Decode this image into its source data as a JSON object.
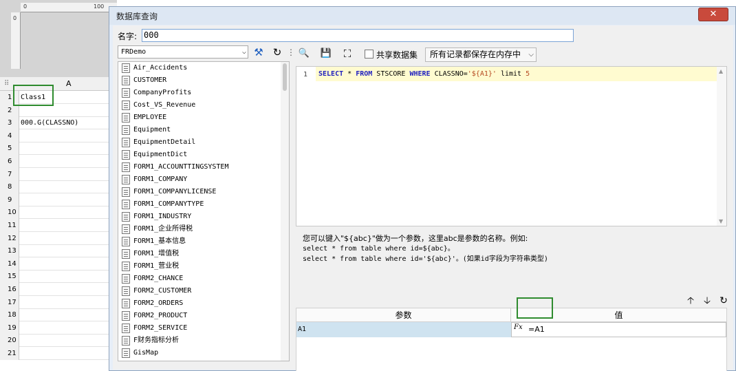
{
  "sheet": {
    "ruler_marks": [
      "0",
      "100"
    ],
    "ruler_left_mark": "0",
    "column_a": "A",
    "rows": [
      {
        "num": "1",
        "value": "Class1"
      },
      {
        "num": "2",
        "value": ""
      },
      {
        "num": "3",
        "value": "000.G(CLASSNO)"
      },
      {
        "num": "4",
        "value": ""
      },
      {
        "num": "5",
        "value": ""
      },
      {
        "num": "6",
        "value": ""
      },
      {
        "num": "7",
        "value": ""
      },
      {
        "num": "8",
        "value": ""
      },
      {
        "num": "9",
        "value": ""
      },
      {
        "num": "10",
        "value": ""
      },
      {
        "num": "11",
        "value": ""
      },
      {
        "num": "12",
        "value": ""
      },
      {
        "num": "13",
        "value": ""
      },
      {
        "num": "14",
        "value": ""
      },
      {
        "num": "15",
        "value": ""
      },
      {
        "num": "16",
        "value": ""
      },
      {
        "num": "17",
        "value": ""
      },
      {
        "num": "18",
        "value": ""
      },
      {
        "num": "19",
        "value": ""
      },
      {
        "num": "20",
        "value": ""
      },
      {
        "num": "21",
        "value": ""
      }
    ]
  },
  "dialog": {
    "title": "数据库查询",
    "close_label": "✕",
    "name_label": "名字:",
    "name_value": "000",
    "datasource": "FRDemo",
    "tables": [
      "Air_Accidents",
      "CUSTOMER",
      "CompanyProfits",
      "Cost_VS_Revenue",
      "EMPLOYEE",
      "Equipment",
      "EquipmentDetail",
      "EquipmentDict",
      "FORM1_ACCOUNTTINGSYSTEM",
      "FORM1_COMPANY",
      "FORM1_COMPANYLICENSE",
      "FORM1_COMPANYTYPE",
      "FORM1_INDUSTRY",
      "FORM1_企业所得税",
      "FORM1_基本信息",
      "FORM1_增值税",
      "FORM1_营业税",
      "FORM2_CHANCE",
      "FORM2_CUSTOMER",
      "FORM2_ORDERS",
      "FORM2_PRODUCT",
      "FORM2_SERVICE",
      "F财务指标分析",
      "GisMap"
    ],
    "share_label": "共享数据集",
    "memory_option": "所有记录都保存在内存中",
    "sql": {
      "line_number": "1",
      "kw1": "SELECT",
      "star": " * ",
      "kw2": "FROM",
      "table": " STSCORE ",
      "kw3": "WHERE",
      "cond": " CLASSNO=",
      "param": "'${A1}'",
      "limit": " limit ",
      "limit_num": "5"
    },
    "hint_line1": "您可以键入\"${abc}\"做为一个参数，这里abc是参数的名称。例如:",
    "hint_line2": "select * from table where id=${abc}。",
    "hint_line3": "select * from table where id='${abc}'。(如果id字段为字符串类型)",
    "param_header": "参数",
    "value_header": "值",
    "param_name": "A1",
    "param_fx": "Fx",
    "param_formula": "=A1"
  }
}
